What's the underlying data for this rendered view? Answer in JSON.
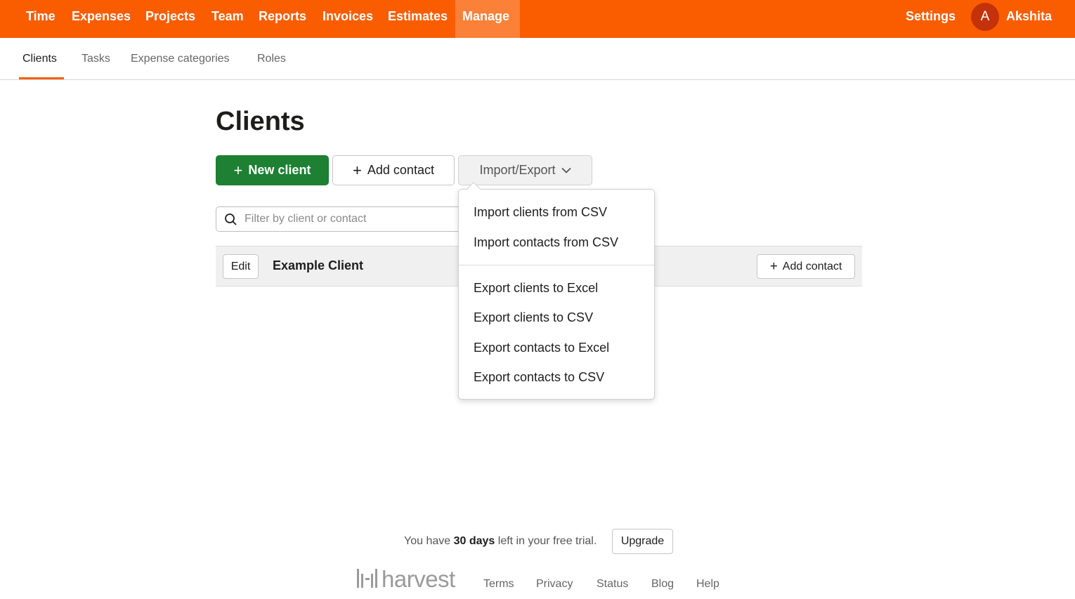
{
  "topnav": {
    "items": [
      "Time",
      "Expenses",
      "Projects",
      "Team",
      "Reports",
      "Invoices",
      "Estimates",
      "Manage"
    ],
    "active": "Manage",
    "settings": "Settings",
    "user_initial": "A",
    "user_name": "Akshita"
  },
  "subnav": {
    "items": [
      "Clients",
      "Tasks",
      "Expense categories",
      "Roles"
    ],
    "active": "Clients"
  },
  "page": {
    "title": "Clients",
    "new_client": "New client",
    "add_contact": "Add contact",
    "import_export": "Import/Export"
  },
  "search": {
    "placeholder": "Filter by client or contact",
    "value": ""
  },
  "clients": [
    {
      "edit_label": "Edit",
      "name": "Example Client",
      "add_contact_label": "Add contact"
    }
  ],
  "dropdown": {
    "import_items": [
      "Import clients from CSV",
      "Import contacts from CSV"
    ],
    "export_items": [
      "Export clients to Excel",
      "Export clients to CSV",
      "Export contacts to Excel",
      "Export contacts to CSV"
    ]
  },
  "footer": {
    "trial_prefix": "You have",
    "trial_days": "30 days",
    "trial_suffix": "left in your free trial.",
    "upgrade": "Upgrade",
    "logo_text": "harvest",
    "links": [
      "Terms",
      "Privacy",
      "Status",
      "Blog",
      "Help"
    ]
  },
  "colors": {
    "brand_orange": "#fa5d00",
    "primary_green": "#1d8033",
    "avatar": "#c4320a"
  }
}
